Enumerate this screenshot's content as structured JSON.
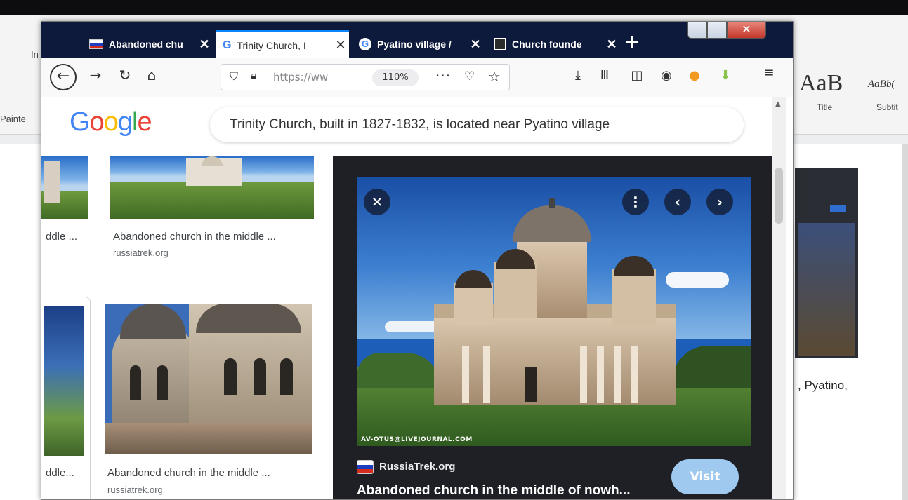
{
  "browser": {
    "tabs": [
      {
        "label": "Abandoned chu",
        "favicon": "russia-flag-icon"
      },
      {
        "label": "Trinity Church, I",
        "favicon": "google-g-icon"
      },
      {
        "label": "Pyatino village /",
        "favicon": "google-g-icon"
      },
      {
        "label": "Church founde",
        "favicon": "site-logo-icon"
      }
    ],
    "url": "https://ww",
    "zoom": "110%"
  },
  "google": {
    "logo": "Google",
    "query": "Trinity Church, built in 1827-1832, is located near Pyatino village"
  },
  "results": [
    {
      "caption": "Abandoned church in the middle ...",
      "source": "russiatrek.org"
    },
    {
      "caption": "Abandoned church in the middle ...",
      "source": "russiatrek.org"
    }
  ],
  "left_column": {
    "caption1": "ddle ...",
    "caption2": "ddle..."
  },
  "preview": {
    "site": "RussiaTrek.org",
    "title": "Abandoned church in the middle of nowh...",
    "visit_label": "Visit",
    "watermark": "AV-OTUS@LIVEJOURNAL.COM"
  },
  "word_background": {
    "style_sample_1": "AaB",
    "style_sample_2": "AaBb(",
    "style_label_1": "Title",
    "style_label_2": "Subtit",
    "painter": "Painte",
    "insert_tab": "In",
    "doc_text": ", Pyatino,"
  },
  "colors": {
    "tabstrip": "#0e1a3c",
    "active_tab_accent": "#0a84ff",
    "preview_bg": "#1f2025",
    "visit_button": "#9fc9ee"
  }
}
